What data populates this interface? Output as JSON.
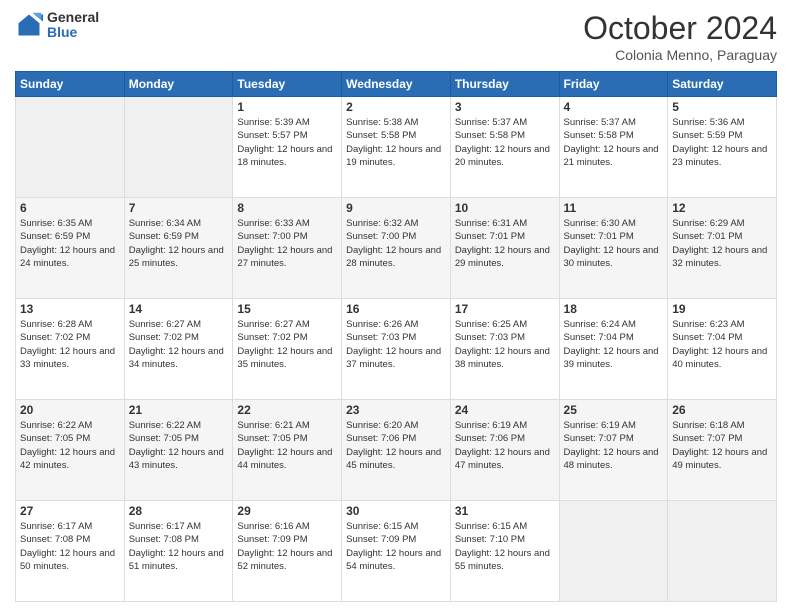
{
  "logo": {
    "general": "General",
    "blue": "Blue"
  },
  "header": {
    "title": "October 2024",
    "subtitle": "Colonia Menno, Paraguay"
  },
  "weekdays": [
    "Sunday",
    "Monday",
    "Tuesday",
    "Wednesday",
    "Thursday",
    "Friday",
    "Saturday"
  ],
  "weeks": [
    [
      {
        "day": "",
        "info": ""
      },
      {
        "day": "",
        "info": ""
      },
      {
        "day": "1",
        "info": "Sunrise: 5:39 AM\nSunset: 5:57 PM\nDaylight: 12 hours and 18 minutes."
      },
      {
        "day": "2",
        "info": "Sunrise: 5:38 AM\nSunset: 5:58 PM\nDaylight: 12 hours and 19 minutes."
      },
      {
        "day": "3",
        "info": "Sunrise: 5:37 AM\nSunset: 5:58 PM\nDaylight: 12 hours and 20 minutes."
      },
      {
        "day": "4",
        "info": "Sunrise: 5:37 AM\nSunset: 5:58 PM\nDaylight: 12 hours and 21 minutes."
      },
      {
        "day": "5",
        "info": "Sunrise: 5:36 AM\nSunset: 5:59 PM\nDaylight: 12 hours and 23 minutes."
      }
    ],
    [
      {
        "day": "6",
        "info": "Sunrise: 6:35 AM\nSunset: 6:59 PM\nDaylight: 12 hours and 24 minutes."
      },
      {
        "day": "7",
        "info": "Sunrise: 6:34 AM\nSunset: 6:59 PM\nDaylight: 12 hours and 25 minutes."
      },
      {
        "day": "8",
        "info": "Sunrise: 6:33 AM\nSunset: 7:00 PM\nDaylight: 12 hours and 27 minutes."
      },
      {
        "day": "9",
        "info": "Sunrise: 6:32 AM\nSunset: 7:00 PM\nDaylight: 12 hours and 28 minutes."
      },
      {
        "day": "10",
        "info": "Sunrise: 6:31 AM\nSunset: 7:01 PM\nDaylight: 12 hours and 29 minutes."
      },
      {
        "day": "11",
        "info": "Sunrise: 6:30 AM\nSunset: 7:01 PM\nDaylight: 12 hours and 30 minutes."
      },
      {
        "day": "12",
        "info": "Sunrise: 6:29 AM\nSunset: 7:01 PM\nDaylight: 12 hours and 32 minutes."
      }
    ],
    [
      {
        "day": "13",
        "info": "Sunrise: 6:28 AM\nSunset: 7:02 PM\nDaylight: 12 hours and 33 minutes."
      },
      {
        "day": "14",
        "info": "Sunrise: 6:27 AM\nSunset: 7:02 PM\nDaylight: 12 hours and 34 minutes."
      },
      {
        "day": "15",
        "info": "Sunrise: 6:27 AM\nSunset: 7:02 PM\nDaylight: 12 hours and 35 minutes."
      },
      {
        "day": "16",
        "info": "Sunrise: 6:26 AM\nSunset: 7:03 PM\nDaylight: 12 hours and 37 minutes."
      },
      {
        "day": "17",
        "info": "Sunrise: 6:25 AM\nSunset: 7:03 PM\nDaylight: 12 hours and 38 minutes."
      },
      {
        "day": "18",
        "info": "Sunrise: 6:24 AM\nSunset: 7:04 PM\nDaylight: 12 hours and 39 minutes."
      },
      {
        "day": "19",
        "info": "Sunrise: 6:23 AM\nSunset: 7:04 PM\nDaylight: 12 hours and 40 minutes."
      }
    ],
    [
      {
        "day": "20",
        "info": "Sunrise: 6:22 AM\nSunset: 7:05 PM\nDaylight: 12 hours and 42 minutes."
      },
      {
        "day": "21",
        "info": "Sunrise: 6:22 AM\nSunset: 7:05 PM\nDaylight: 12 hours and 43 minutes."
      },
      {
        "day": "22",
        "info": "Sunrise: 6:21 AM\nSunset: 7:05 PM\nDaylight: 12 hours and 44 minutes."
      },
      {
        "day": "23",
        "info": "Sunrise: 6:20 AM\nSunset: 7:06 PM\nDaylight: 12 hours and 45 minutes."
      },
      {
        "day": "24",
        "info": "Sunrise: 6:19 AM\nSunset: 7:06 PM\nDaylight: 12 hours and 47 minutes."
      },
      {
        "day": "25",
        "info": "Sunrise: 6:19 AM\nSunset: 7:07 PM\nDaylight: 12 hours and 48 minutes."
      },
      {
        "day": "26",
        "info": "Sunrise: 6:18 AM\nSunset: 7:07 PM\nDaylight: 12 hours and 49 minutes."
      }
    ],
    [
      {
        "day": "27",
        "info": "Sunrise: 6:17 AM\nSunset: 7:08 PM\nDaylight: 12 hours and 50 minutes."
      },
      {
        "day": "28",
        "info": "Sunrise: 6:17 AM\nSunset: 7:08 PM\nDaylight: 12 hours and 51 minutes."
      },
      {
        "day": "29",
        "info": "Sunrise: 6:16 AM\nSunset: 7:09 PM\nDaylight: 12 hours and 52 minutes."
      },
      {
        "day": "30",
        "info": "Sunrise: 6:15 AM\nSunset: 7:09 PM\nDaylight: 12 hours and 54 minutes."
      },
      {
        "day": "31",
        "info": "Sunrise: 6:15 AM\nSunset: 7:10 PM\nDaylight: 12 hours and 55 minutes."
      },
      {
        "day": "",
        "info": ""
      },
      {
        "day": "",
        "info": ""
      }
    ]
  ]
}
